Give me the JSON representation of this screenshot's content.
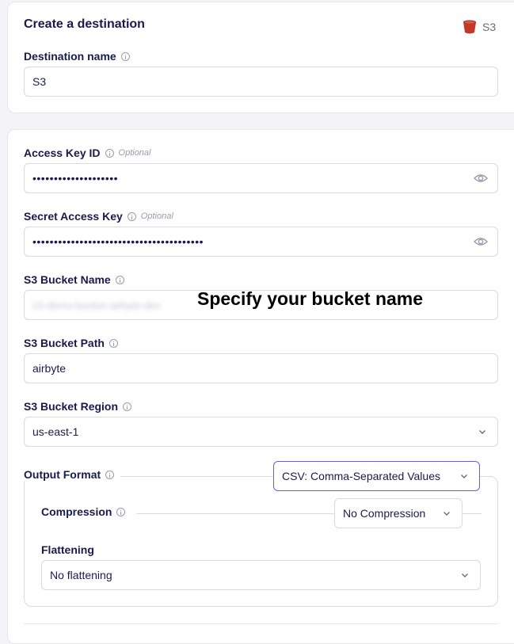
{
  "header": {
    "title": "Create a destination",
    "connector_label": "S3"
  },
  "fields": {
    "destination_name": {
      "label": "Destination name",
      "value": "S3"
    },
    "access_key_id": {
      "label": "Access Key ID",
      "optional": "Optional",
      "value": "••••••••••••••••••••"
    },
    "secret_access_key": {
      "label": "Secret Access Key",
      "optional": "Optional",
      "value": "••••••••••••••••••••••••••••••••••••••••"
    },
    "bucket_name": {
      "label": "S3 Bucket Name",
      "value": "s3-demo-bucket-airbyte-dev",
      "annotation": "Specify your bucket name"
    },
    "bucket_path": {
      "label": "S3 Bucket Path",
      "value": "airbyte"
    },
    "bucket_region": {
      "label": "S3 Bucket Region",
      "value": "us-east-1"
    },
    "output_format": {
      "label": "Output Format",
      "value": "CSV: Comma-Separated Values"
    },
    "compression": {
      "label": "Compression",
      "value": "No Compression"
    },
    "flattening": {
      "label": "Flattening",
      "value": "No flattening"
    }
  },
  "colors": {
    "text": "#1a194d",
    "muted": "#9a9aad",
    "border": "#d9d9e0",
    "accent": "#615eff",
    "bucket_red": "#c0392b"
  },
  "icons": {
    "info": "info-icon",
    "eye": "eye-icon",
    "chevron": "chevron-down-icon",
    "bucket": "s3-bucket-icon"
  }
}
